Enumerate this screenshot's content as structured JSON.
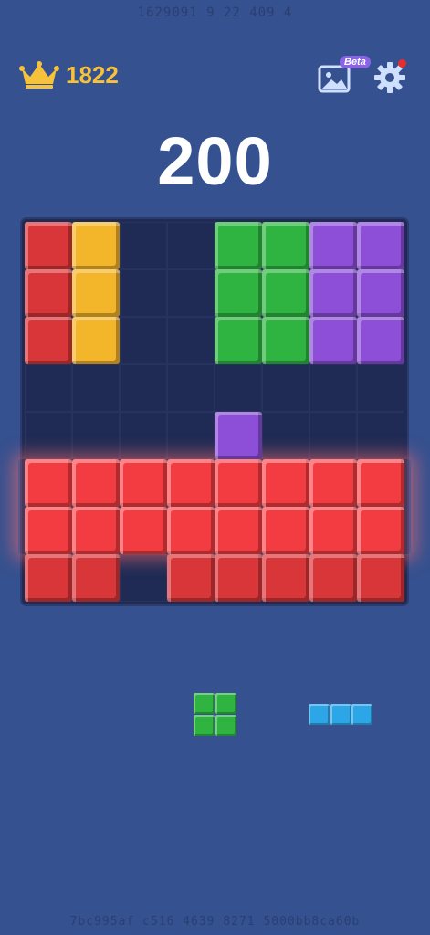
{
  "status_overlay": "1629091 9 22 409 4",
  "footer_overlay": "7bc995af c516 4639 8271 5000bb8ca60b",
  "header": {
    "best_score": "1822",
    "beta_label": "Beta",
    "crown_icon": "crown-icon",
    "theme_icon": "image-icon",
    "settings_icon": "gear-icon"
  },
  "score": "200",
  "colors": {
    "red": "#d9363a",
    "yellow": "#f3b52a",
    "green": "#2fb442",
    "purple": "#8d4fd8",
    "cyan": "#2ca6e6",
    "background": "#36518f",
    "board": "#1f2b55"
  },
  "board": {
    "size": 8,
    "rows": [
      "RY..GGPP",
      "RY..GGPP",
      "RY..GGPP",
      "........",
      "....P...",
      "RRRRRRRR",
      "RRRRRRRR",
      "RR.RRRRR"
    ],
    "clearing_rows": [
      5,
      6
    ]
  },
  "tray": [
    {
      "name": "green-square-piece",
      "color": "green",
      "cells": [
        [
          0,
          0
        ],
        [
          1,
          0
        ],
        [
          0,
          1
        ],
        [
          1,
          1
        ]
      ]
    },
    {
      "name": "cyan-line-piece",
      "color": "cyan",
      "cells": [
        [
          0,
          0
        ],
        [
          1,
          0
        ],
        [
          2,
          0
        ]
      ]
    }
  ]
}
